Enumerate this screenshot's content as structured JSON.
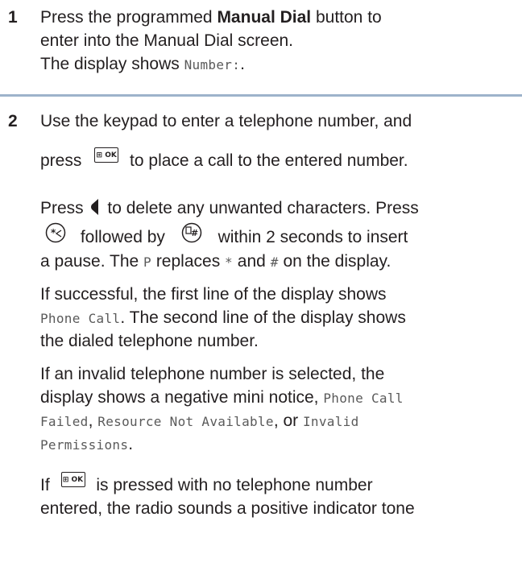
{
  "step1": {
    "number": "1",
    "line1_pre": "Press the programmed ",
    "line1_bold": "Manual Dial",
    "line1_post": " button to",
    "line2": "enter into the Manual Dial screen.",
    "line3_pre": "The display shows ",
    "line3_mono": "Number:",
    "line3_post": "."
  },
  "step2": {
    "number": "2",
    "p1_line1": "Use the keypad to enter a telephone number, and",
    "p1_line2_pre": "press",
    "p1_line2_post": "to place a call to the entered number.",
    "p2_line1_pre": "Press",
    "p2_line1_post": "to delete any unwanted characters. Press",
    "p2_line2_mid": "followed by",
    "p2_line2_post": "within 2 seconds to insert",
    "p2_line3_a": "a pause. The ",
    "p2_line3_mono1": "P",
    "p2_line3_b": " replaces ",
    "p2_line3_mono2": "*",
    "p2_line3_c": " and ",
    "p2_line3_mono3": "#",
    "p2_line3_d": " on the display.",
    "p3_line1": "If successful, the first line of the display shows",
    "p3_line2_mono": "Phone Call",
    "p3_line2_post": ". The second line of the display shows",
    "p3_line3": "the dialed telephone number.",
    "p4_line1": "If an invalid telephone number is selected, the",
    "p4_line2_pre": "display shows a negative mini notice, ",
    "p4_line2_mono": "Phone Call",
    "p4_line3_mono1": "Failed",
    "p4_line3_sep1": ", ",
    "p4_line3_mono2": "Resource Not Available",
    "p4_line3_sep2": ", or ",
    "p4_line3_mono3": "Invalid",
    "p4_line4_mono": "Permissions",
    "p4_line4_post": ".",
    "p5_line1_pre": "If",
    "p5_line1_post": "is pressed with no telephone number",
    "p5_line2": "entered, the radio sounds a positive indicator tone"
  },
  "keys": {
    "ok_key_label": "⊞ OK",
    "ok_key_icon": "menu-ok-key-icon",
    "left_key_icon": "left-arrow-key-icon",
    "star_key_icon": "star-key-icon",
    "hash_key_icon": "hash-key-icon"
  }
}
